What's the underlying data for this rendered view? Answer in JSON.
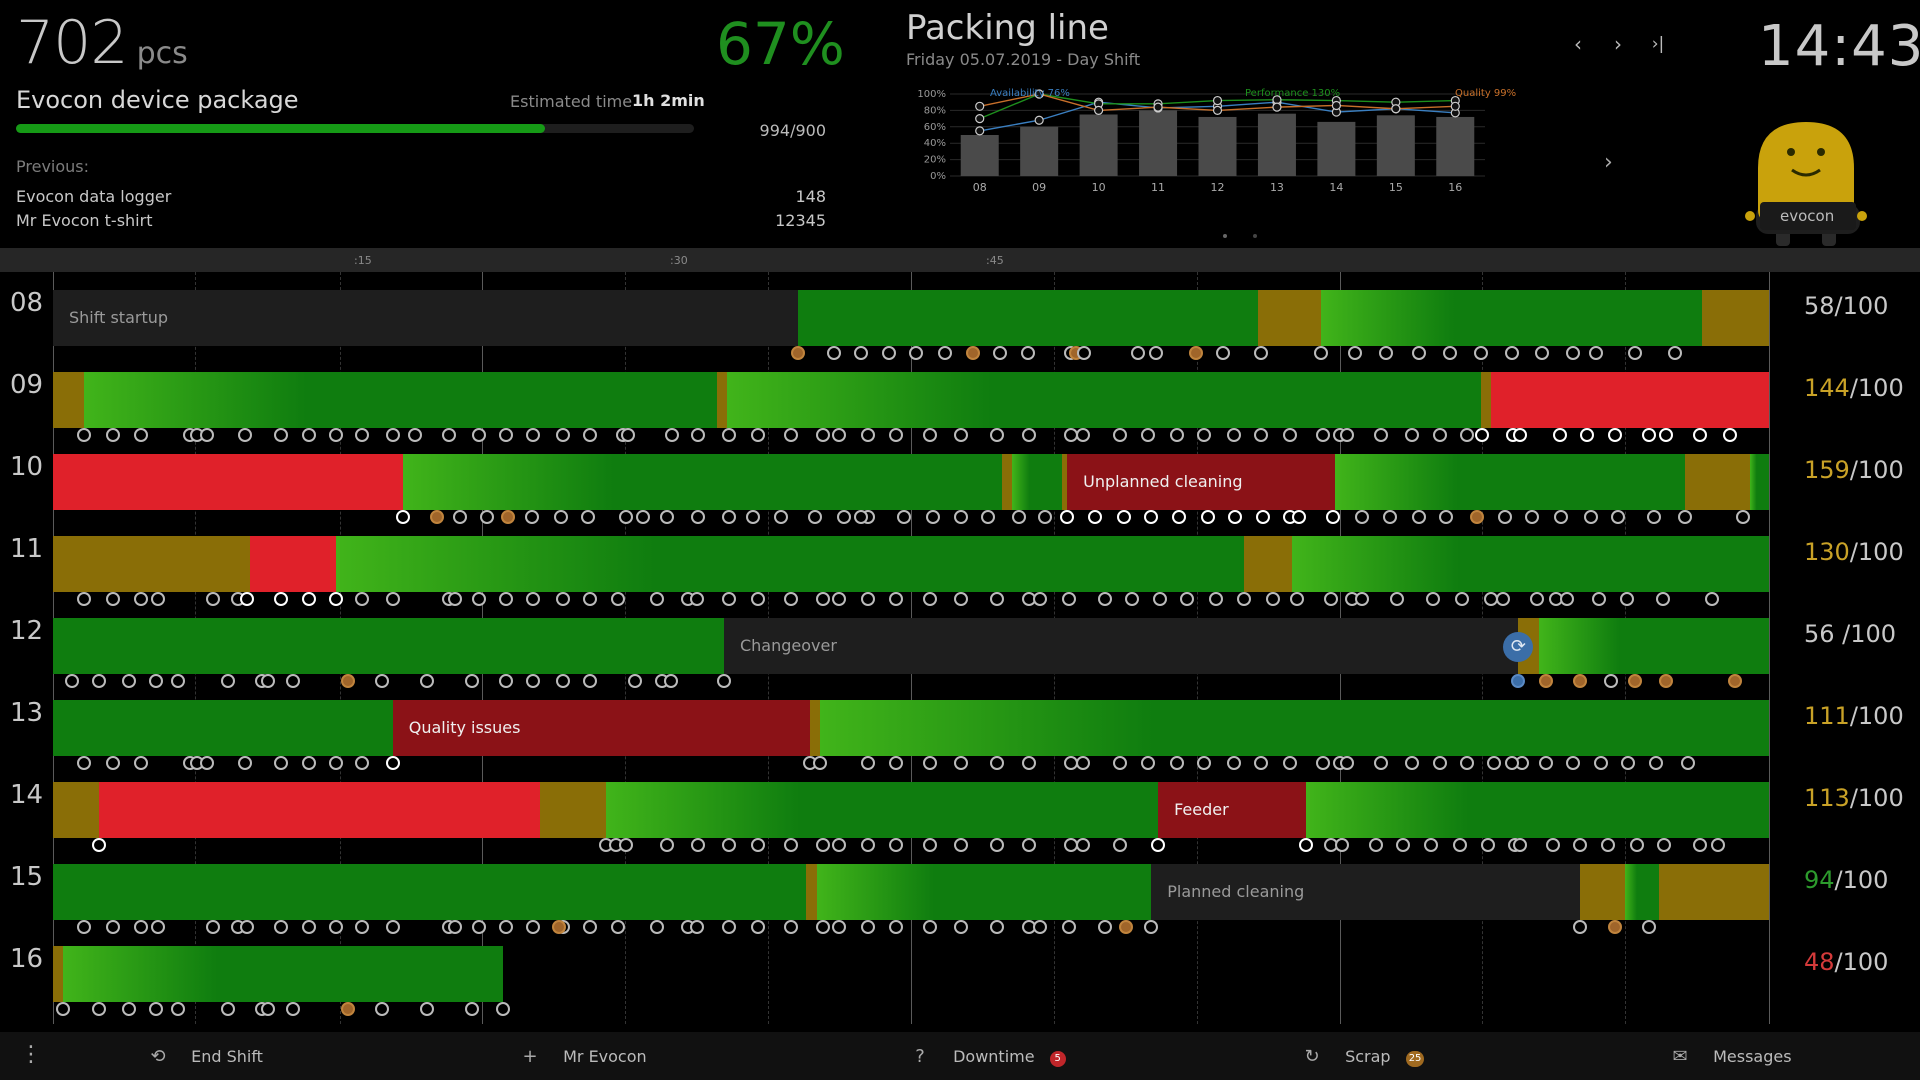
{
  "header": {
    "count_value": "702",
    "count_unit": "pcs",
    "oee": "67%",
    "product_name": "Evocon device package",
    "estimated_label": "Estimated time",
    "estimated_value": "1h 2min",
    "progress_fraction": 0.78,
    "ratio": "994/900",
    "previous_label": "Previous:",
    "previous_items": [
      {
        "name": "Evocon data logger",
        "value": "148"
      },
      {
        "name": "Mr Evocon t-shirt",
        "value": "12345"
      }
    ],
    "line_title": "Packing line",
    "line_subtitle": "Friday 05.07.2019 - Day Shift",
    "nav": {
      "prev": "‹",
      "next": "›",
      "last": "›|"
    },
    "clock": "14:43",
    "mascot_label": "evocon"
  },
  "chart_data": {
    "type": "bar",
    "categories": [
      "08",
      "09",
      "10",
      "11",
      "12",
      "13",
      "14",
      "15",
      "16"
    ],
    "ylim": [
      0,
      100
    ],
    "ticks": [
      "0%",
      "20%",
      "40%",
      "60%",
      "80%",
      "100%"
    ],
    "legend": [
      "Availability 76%",
      "Performance 130%",
      "Quality 99%"
    ],
    "legend_colors": [
      "#3a7fc1",
      "#1d8f1d",
      "#c8702a"
    ],
    "series": [
      {
        "name": "Availability 76%",
        "type": "line",
        "color": "#3a7fc1",
        "values": [
          55,
          68,
          90,
          83,
          85,
          90,
          78,
          82,
          77
        ]
      },
      {
        "name": "Performance 130%",
        "type": "line",
        "color": "#1d8f1d",
        "values": [
          70,
          100,
          88,
          88,
          92,
          93,
          92,
          90,
          92
        ]
      },
      {
        "name": "Quality 99%",
        "type": "line",
        "color": "#c8702a",
        "values": [
          85,
          100,
          80,
          84,
          80,
          84,
          86,
          82,
          85
        ]
      },
      {
        "name": "OEE",
        "type": "bar",
        "color": "#4a4a4a",
        "values": [
          50,
          60,
          75,
          80,
          72,
          76,
          66,
          74,
          72
        ]
      }
    ]
  },
  "ruler": {
    "ticks": [
      ":15",
      ":30",
      ":45"
    ]
  },
  "rows": [
    {
      "hour": "08",
      "score_main": "58",
      "score_rest": "/100",
      "score_class": "score-rest",
      "segments": [
        {
          "s": 0.0,
          "e": 0.434,
          "c": "dark",
          "label": "Shift startup"
        },
        {
          "s": 0.434,
          "e": 0.702,
          "c": "green"
        },
        {
          "s": 0.702,
          "e": 0.739,
          "c": "yellow"
        },
        {
          "s": 0.739,
          "e": 0.961,
          "c": "green"
        },
        {
          "s": 0.961,
          "e": 1.0,
          "c": "yellow"
        }
      ],
      "dots": "0.434o 0.455 0.471 0.487 0.503 0.52 0.536o 0.552 0.568 0.593 0.596o 0.601 0.632 0.643 0.666o 0.682 0.704 0.739 0.759 0.777 0.796 0.814 0.832 0.85 0.868 0.886 0.899 0.922 0.945"
    },
    {
      "hour": "09",
      "score_main": "144",
      "score_rest": "/100",
      "score_class": "score-hi",
      "segments": [
        {
          "s": 0.0,
          "e": 0.018,
          "c": "yellow"
        },
        {
          "s": 0.018,
          "e": 0.387,
          "c": "green"
        },
        {
          "s": 0.387,
          "e": 0.393,
          "c": "yellow"
        },
        {
          "s": 0.393,
          "e": 0.832,
          "c": "green"
        },
        {
          "s": 0.832,
          "e": 0.838,
          "c": "yellow"
        },
        {
          "s": 0.838,
          "e": 1.0,
          "c": "red"
        }
      ],
      "dots": "0.018 0.035 0.051 0.08 0.084 0.09 0.112 0.133 0.149 0.165 0.18 0.198 0.211 0.231 0.248 0.264 0.28 0.297 0.313 0.332 0.335 0.361 0.376 0.394 0.411 0.43 0.449 0.458 0.475 0.491 0.511 0.529 0.55 0.569 0.593 0.6 0.622 0.638 0.655 0.671 0.688 0.704 0.721 0.74 0.75 0.754 0.774 0.792 0.808 0.824 0.833w 0.851w 0.855w 0.878w 0.894w 0.91w 0.93w 0.94w 0.96w 0.977w"
    },
    {
      "hour": "10",
      "score_main": "159",
      "score_rest": "/100",
      "score_class": "score-hi",
      "segments": [
        {
          "s": 0.0,
          "e": 0.204,
          "c": "red"
        },
        {
          "s": 0.204,
          "e": 0.553,
          "c": "green"
        },
        {
          "s": 0.553,
          "e": 0.559,
          "c": "yellow"
        },
        {
          "s": 0.559,
          "e": 0.588,
          "c": "green"
        },
        {
          "s": 0.588,
          "e": 0.591,
          "c": "yellow"
        },
        {
          "s": 0.591,
          "e": 0.747,
          "c": "darkred",
          "label": "Unplanned cleaning"
        },
        {
          "s": 0.747,
          "e": 0.951,
          "c": "green"
        },
        {
          "s": 0.951,
          "e": 0.989,
          "c": "yellow"
        },
        {
          "s": 0.989,
          "e": 1.0,
          "c": "green"
        }
      ],
      "dots": "0.204w 0.224o 0.237 0.253 0.265o 0.279 0.296 0.312 0.334 0.344 0.358 0.376 0.394 0.408 0.424 0.444 0.461 0.475 0.471 0.496 0.513 0.529 0.545 0.563 0.578 0.591w 0.607w 0.624w 0.64w 0.656w 0.673w 0.689w 0.705w 0.721w 0.726w 0.746w 0.763 0.779 0.796 0.812 0.83o 0.846 0.862 0.879 0.896 0.912 0.933 0.951 0.985"
    },
    {
      "hour": "11",
      "score_main": "130",
      "score_rest": "/100",
      "score_class": "score-hi",
      "segments": [
        {
          "s": 0.0,
          "e": 0.115,
          "c": "yellow"
        },
        {
          "s": 0.115,
          "e": 0.165,
          "c": "red"
        },
        {
          "s": 0.165,
          "e": 0.694,
          "c": "green"
        },
        {
          "s": 0.694,
          "e": 0.722,
          "c": "yellow"
        },
        {
          "s": 0.722,
          "e": 1.0,
          "c": "green"
        }
      ],
      "dots": "0.018 0.035 0.051 0.061 0.093 0.108 0.113w 0.133w 0.149w 0.165w 0.18 0.198 0.231 0.234 0.248 0.264 0.28 0.297 0.313 0.329 0.352 0.37 0.375 0.394 0.411 0.43 0.449 0.458 0.475 0.491 0.511 0.529 0.55 0.569 0.575 0.592 0.613 0.629 0.645 0.661 0.678 0.694 0.711 0.725 0.745 0.757 0.763 0.783 0.804 0.821 0.838 0.845 0.865 0.876 0.882 0.901 0.917 0.938 0.967"
    },
    {
      "hour": "12",
      "score_main": "56",
      "score_rest": " /100",
      "score_class": "score-rest",
      "segments": [
        {
          "s": 0.0,
          "e": 0.391,
          "c": "green"
        },
        {
          "s": 0.391,
          "e": 0.854,
          "c": "dark",
          "label": "Changeover"
        },
        {
          "s": 0.854,
          "e": 0.866,
          "c": "yellow"
        },
        {
          "s": 0.866,
          "e": 1.0,
          "c": "green"
        }
      ],
      "dots": "0.011 0.027 0.044 0.06 0.073 0.102 0.122 0.125 0.14 0.172o 0.192 0.218 0.244 0.264 0.28 0.297 0.313 0.339 0.355 0.36 0.391 0.854b 0.87o 0.89o 0.908 0.922o 0.94o 0.98o",
      "sync_at": 0.854
    },
    {
      "hour": "13",
      "score_main": "111",
      "score_rest": "/100",
      "score_class": "score-hi",
      "segments": [
        {
          "s": 0.0,
          "e": 0.198,
          "c": "green"
        },
        {
          "s": 0.198,
          "e": 0.441,
          "c": "darkred",
          "label": "Quality issues"
        },
        {
          "s": 0.441,
          "e": 0.447,
          "c": "yellow"
        },
        {
          "s": 0.447,
          "e": 1.0,
          "c": "green"
        }
      ],
      "dots": "0.018 0.035 0.051 0.08 0.084 0.09 0.112 0.133 0.149 0.165 0.18 0.198w 0.441 0.447 0.475 0.491 0.511 0.529 0.55 0.569 0.593 0.6 0.622 0.638 0.655 0.671 0.688 0.704 0.721 0.74 0.75 0.754 0.774 0.792 0.808 0.824 0.84 0.856 0.85 0.87 0.886 0.902 0.918 0.934 0.953"
    },
    {
      "hour": "14",
      "score_main": "113",
      "score_rest": "/100",
      "score_class": "score-hi",
      "segments": [
        {
          "s": 0.0,
          "e": 0.027,
          "c": "yellow"
        },
        {
          "s": 0.027,
          "e": 0.284,
          "c": "red"
        },
        {
          "s": 0.284,
          "e": 0.322,
          "c": "yellow"
        },
        {
          "s": 0.322,
          "e": 0.644,
          "c": "green"
        },
        {
          "s": 0.644,
          "e": 0.73,
          "c": "darkred",
          "label": "Feeder"
        },
        {
          "s": 0.73,
          "e": 1.0,
          "c": "green"
        }
      ],
      "dots": "0.027w 0.322 0.328 0.334 0.358 0.376 0.394 0.411 0.43 0.449 0.458 0.475 0.491 0.511 0.529 0.55 0.569 0.593 0.6 0.622 0.644w 0.73w 0.745 0.751 0.771 0.787 0.803 0.82 0.836 0.852 0.855 0.874 0.89 0.906 0.923 0.939 0.96 0.97"
    },
    {
      "hour": "15",
      "score_main": "94",
      "score_rest": "/100",
      "score_class": "score-mid",
      "segments": [
        {
          "s": 0.0,
          "e": 0.439,
          "c": "green"
        },
        {
          "s": 0.439,
          "e": 0.445,
          "c": "yellow"
        },
        {
          "s": 0.445,
          "e": 0.64,
          "c": "green"
        },
        {
          "s": 0.64,
          "e": 0.89,
          "c": "dark",
          "label": "Planned cleaning"
        },
        {
          "s": 0.89,
          "e": 0.916,
          "c": "yellow"
        },
        {
          "s": 0.916,
          "e": 0.936,
          "c": "green"
        },
        {
          "s": 0.936,
          "e": 1.0,
          "c": "yellow"
        }
      ],
      "dots": "0.018 0.035 0.051 0.061 0.093 0.108 0.113 0.133 0.149 0.165 0.18 0.198 0.231 0.234 0.248 0.264 0.28 0.297 0.295o 0.313 0.329 0.352 0.37 0.375 0.394 0.411 0.43 0.449 0.458 0.475 0.491 0.511 0.529 0.55 0.569 0.575 0.592 0.613 0.625o 0.64 0.89 0.91o 0.93"
    },
    {
      "hour": "16",
      "score_main": "48",
      "score_rest": "/100",
      "score_class": "score-lo",
      "segments": [
        {
          "s": 0.0,
          "e": 0.006,
          "c": "yellow"
        },
        {
          "s": 0.006,
          "e": 0.262,
          "c": "green"
        }
      ],
      "dots": "0.006 0.027 0.044 0.06 0.073 0.102 0.122 0.125 0.14 0.172o 0.192 0.218 0.244 0.262"
    }
  ],
  "footer": {
    "menu": "⋮",
    "items": [
      {
        "key": "end_shift",
        "label": "End Shift",
        "icon": "history-icon",
        "glyph": "⟲"
      },
      {
        "key": "operator",
        "label": "Mr Evocon",
        "icon": "add-person-icon",
        "glyph": "+"
      },
      {
        "key": "downtime",
        "label": "Downtime",
        "icon": "help-circle-icon",
        "glyph": "?",
        "badge": "5",
        "badge_color": "#c0262a"
      },
      {
        "key": "scrap",
        "label": "Scrap",
        "icon": "scrap-icon",
        "glyph": "↻",
        "badge": "25",
        "badge_color": "#a06a20"
      },
      {
        "key": "messages",
        "label": "Messages",
        "icon": "mail-icon",
        "glyph": "✉"
      }
    ]
  },
  "colors": {
    "green": "#0f7d0f",
    "yellow": "#8a6e07",
    "red": "#e0212a",
    "darkred": "#8b1217",
    "dark": "#1e1e1e"
  }
}
